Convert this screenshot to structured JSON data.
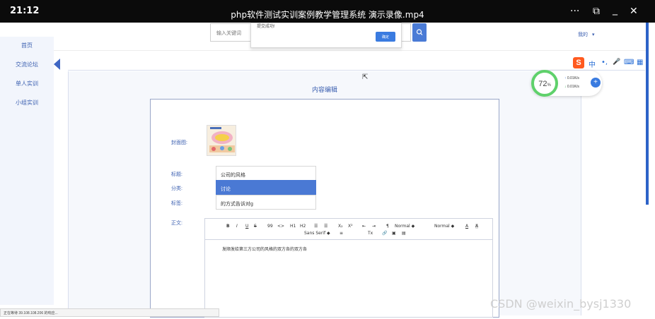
{
  "player": {
    "time": "21:12",
    "title": "php软件测试实训案例教学管理系统 演示录像.mp4",
    "controls": {
      "more": "···",
      "pip": "⧉",
      "minimize": "_",
      "close": "✕"
    }
  },
  "header": {
    "search_placeholder": "输入关键词",
    "user_menu": "我的",
    "user_caret": "▾"
  },
  "popup": {
    "text": "提交成功!",
    "confirm_label": "确定"
  },
  "sidebar": {
    "items": [
      {
        "label": "首页"
      },
      {
        "label": "交流论坛"
      },
      {
        "label": "单人实训"
      },
      {
        "label": "小组实训"
      }
    ]
  },
  "panel": {
    "title": "内容编辑"
  },
  "form": {
    "cover_label": "封面图:",
    "title_label": "标题:",
    "title_value": "公司的风格",
    "category_label": "分类:",
    "category_value": "讨论",
    "tags_label": "标签:",
    "tags_value": "的方式告诉对g",
    "content_label": "正文:"
  },
  "editor": {
    "toolbar": {
      "bold": "B",
      "italic": "I",
      "underline": "U",
      "strike": "S",
      "quote": "99",
      "code": "<>",
      "h1": "H1",
      "h2": "H2",
      "ol": "☰",
      "ul": "☰",
      "sub": "X₂",
      "sup": "X²",
      "indent_out": "⇤",
      "indent_in": "⇥",
      "direction": "¶",
      "size_select": "Normal ◆",
      "header_select": "Normal ◆",
      "color": "A",
      "bg": "A",
      "font_select": "Sans Serif ◆",
      "align": "≡",
      "clean": "Tx",
      "link": "🔗",
      "image": "▣",
      "video": "▤"
    },
    "body_text": "发顺发给第三方公司的风格的双方各的双方各"
  },
  "ime": {
    "logo": "S",
    "items": [
      "中",
      "•,",
      "🎤",
      "⌨",
      "▦"
    ]
  },
  "speed": {
    "percent": "72",
    "percent_suffix": "%",
    "up": "0.01K/s",
    "down": "0.01K/s",
    "plus": "+"
  },
  "status_text": "正在等待 39.108.108.206 的响应...",
  "watermark": "CSDN @weixin_bysj1330",
  "colors": {
    "accent": "#4a79d4",
    "sidebar_bg": "#f2f5fc",
    "ring": "#5fd16b",
    "ime": "#ff5a1f"
  }
}
